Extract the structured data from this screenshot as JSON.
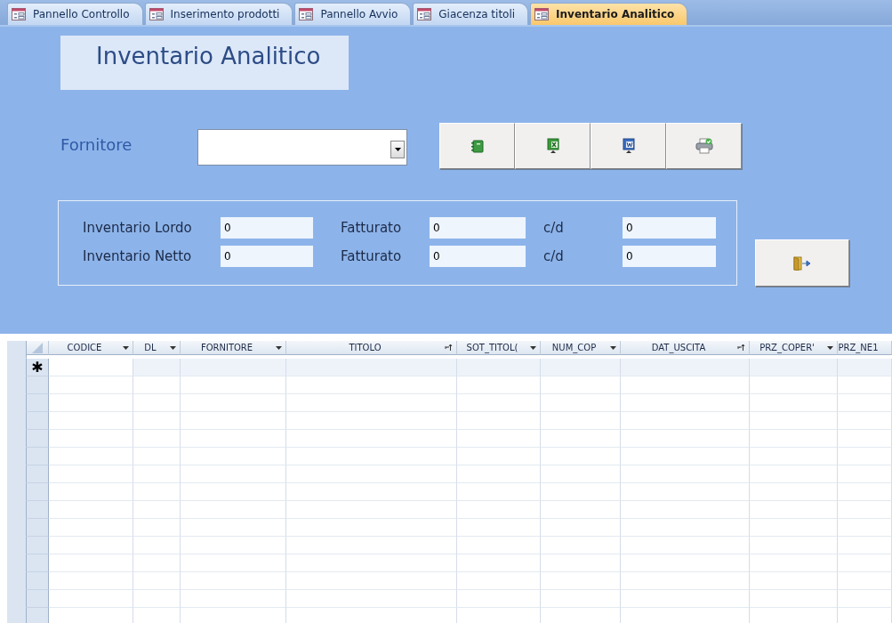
{
  "tabs": [
    {
      "label": "Pannello Controllo",
      "selected": false
    },
    {
      "label": "Inserimento prodotti",
      "selected": false
    },
    {
      "label": "Pannello Avvio",
      "selected": false
    },
    {
      "label": "Giacenza titoli",
      "selected": false
    },
    {
      "label": "Inventario Analitico",
      "selected": true
    }
  ],
  "form": {
    "title": "Inventario Analitico",
    "supplier": {
      "label": "Fornitore"
    },
    "toolbar": [
      {
        "kind": "notebook"
      },
      {
        "kind": "excel"
      },
      {
        "kind": "word"
      },
      {
        "kind": "print"
      }
    ],
    "totals": [
      {
        "label": "Inventario Lordo",
        "value": "0",
        "invoiced_label": "Fatturato",
        "invoiced": "0",
        "cd_label": "c/d",
        "cd": "0"
      },
      {
        "label": "Inventario Netto",
        "value": "0",
        "invoiced_label": "Fatturato",
        "invoiced": "0",
        "cd_label": "c/d",
        "cd": "0"
      }
    ],
    "exit_button": {
      "kind": "exit"
    }
  },
  "table": {
    "columns": [
      {
        "label": "CODICE",
        "sorted": false
      },
      {
        "label": "DL",
        "sorted": false
      },
      {
        "label": "FORNITORE",
        "sorted": false
      },
      {
        "label": "TITOLO",
        "sorted": true
      },
      {
        "label": "SOT_TITOL(",
        "sorted": false
      },
      {
        "label": "NUM_COP",
        "sorted": false
      },
      {
        "label": "DAT_USCITA",
        "sorted": true
      },
      {
        "label": "PRZ_COPER'",
        "sorted": false
      },
      {
        "label": "PRZ_NE1"
      }
    ],
    "new_row_marker": "✱"
  }
}
